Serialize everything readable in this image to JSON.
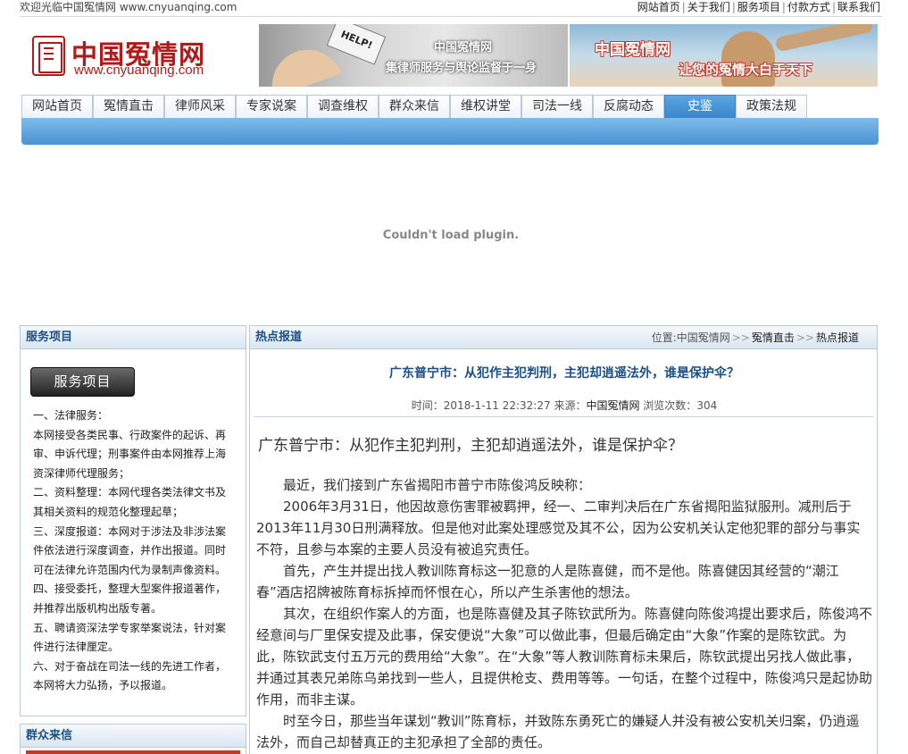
{
  "topbar": {
    "welcome": "欢迎光临中国冤情网 www.cnyuanqing.com",
    "links": [
      "网站首页",
      "关于我们",
      "服务项目",
      "付款方式",
      "联系我们"
    ],
    "separator": "|"
  },
  "logo": {
    "name": "中国冤情网",
    "url": "www.cnyuanqing.com"
  },
  "banner_left": {
    "sign": "HELP!",
    "line1": "中国冤情网",
    "line2": "集律师服务与舆论监督于一身"
  },
  "banner_right": {
    "line1": "中国冤情网",
    "line2": "让您的冤情大白于天下"
  },
  "nav": {
    "items": [
      "网站首页",
      "冤情直击",
      "律师风采",
      "专家说案",
      "调查维权",
      "群众来信",
      "维权讲堂",
      "司法一线",
      "反腐动态",
      "史鉴",
      "政策法规"
    ],
    "active_index": 9
  },
  "plugin_message": "Couldn't load plugin.",
  "sidebar": {
    "title": "服务项目",
    "button": "服务项目",
    "lines": [
      "一、法律服务：",
      "本网接受各类民事、行政案件的起诉、再",
      "审、申诉代理；刑事案件由本网推荐上海",
      "资深律师代理服务；",
      "二、资料整理：本网代理各类法律文书及",
      "其相关资料的规范化整理起草；",
      "三、深度报道：本网对于涉法及非涉法案",
      "件依法进行深度调查，并作出报道。同时",
      "可在法律允许范围内代为录制声像资料。",
      "四、接受委托，整理大型案件报道著作，",
      "并推荐出版机构出版专著。",
      "五、聘请资深法学专家举案说法，针对案",
      "件进行法律厘定。",
      "六、对于奋战在司法一线的先进工作者，",
      "本网将大力弘扬，予以报道。"
    ],
    "second_title": "群众来信"
  },
  "main": {
    "title": "热点报道",
    "breadcrumb": {
      "prefix": "位置:",
      "items": [
        "中国冤情网",
        "冤情直击",
        "热点报道"
      ],
      "separator": ">>"
    },
    "article": {
      "title": "广东普宁市：从犯作主犯判刑，主犯却逍遥法外，谁是保护伞？",
      "time_label": "时间：",
      "time": "2018-1-11 22:32:27",
      "source_label": "来源：",
      "source": "中国冤情网",
      "views_label": "浏览次数：",
      "views": "304",
      "headline": "广东普宁市：从犯作主犯判刑，主犯却逍遥法外，谁是保护伞？",
      "paragraphs": [
        "最近，我们接到广东省揭阳市普宁市陈俊鸿反映称：",
        "2006年3月31日，他因故意伤害罪被羁押，经一、二审判决后在广东省揭阳监狱服刑。减刑后于2013年11月30日刑满释放。但是他对此案处理感觉及其不公，因为公安机关认定他犯罪的部分与事实不符，且参与本案的主要人员没有被追究责任。",
        "首先，产生并提出找人教训陈育标这一犯意的人是陈喜健，而不是他。陈喜健因其经营的“潮江春”酒店招牌被陈育标拆掉而怀恨在心，所以产生杀害他的想法。",
        "其次，在组织作案人的方面，也是陈喜健及其子陈钦武所为。陈喜健向陈俊鸿提出要求后，陈俊鸿不经意间与厂里保安提及此事，保安便说“大象”可以做此事，但最后确定由“大象”作案的是陈钦武。为此，陈钦武支付五万元的费用给“大象”。在“大象”等人教训陈育标未果后，陈钦武提出另找人做此事，并通过其表兄弟陈乌弟找到一些人，且提供枪支、费用等等。一句话，在整个过程中，陈俊鸿只是起协助作用，而非主谋。",
        "时至今日，那些当年谋划“教训”陈育标，并致陈东勇死亡的嫌疑人并没有被公安机关归案，仍逍遥法外，而自己却替真正的主犯承担了全部的责任。"
      ]
    }
  },
  "colors": {
    "brand_red": "#b01b1b",
    "nav_blue": "#4a92d3",
    "title_blue": "#1b4f86"
  }
}
